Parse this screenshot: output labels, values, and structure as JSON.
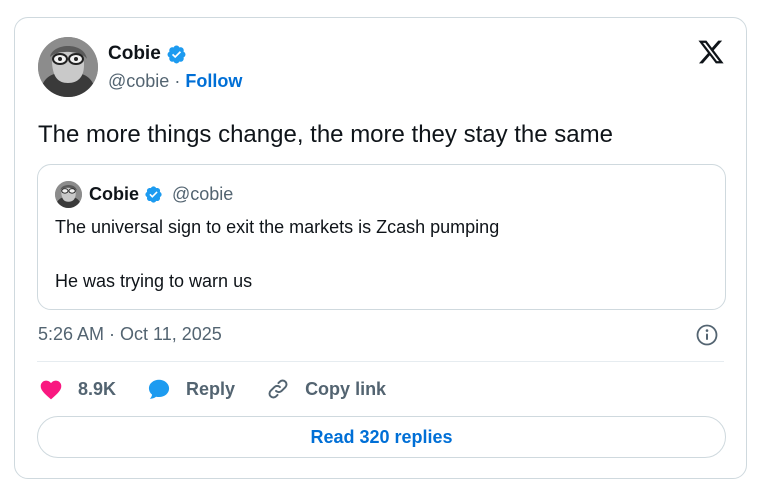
{
  "author": {
    "name": "Cobie",
    "handle": "@cobie",
    "separator": "·",
    "follow_label": "Follow",
    "verified": true,
    "verified_color": "#1d9bf0"
  },
  "tweet": {
    "text": "The more things change, the more they stay the same",
    "timestamp": "5:26 AM · Oct 11, 2025"
  },
  "quoted_tweet": {
    "name": "Cobie",
    "handle": "@cobie",
    "verified": true,
    "line1": "The universal sign to exit the markets is Zcash pumping",
    "line2": "He was trying to warn us"
  },
  "actions": {
    "like_count": "8.9K",
    "reply_label": "Reply",
    "copy_link_label": "Copy link",
    "like_color": "#f91880",
    "reply_color": "#1d9bf0"
  },
  "read_replies_label": "Read 320 replies",
  "icons": {
    "logo": "x-logo-icon",
    "info": "info-icon",
    "like": "heart-icon",
    "reply": "speech-bubble-icon",
    "copy": "link-icon"
  }
}
